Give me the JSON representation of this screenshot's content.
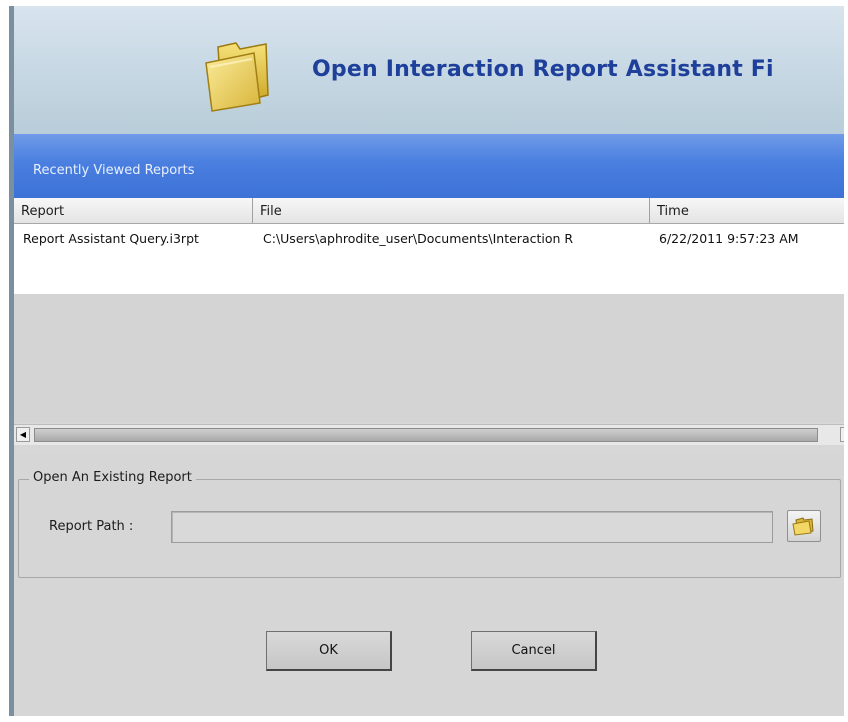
{
  "header": {
    "title": "Open Interaction Report Assistant Fi",
    "icon": "folder-icon"
  },
  "recent": {
    "section_label": "Recently Viewed Reports",
    "columns": [
      "Report",
      "File",
      "Time"
    ],
    "rows": [
      {
        "report": "Report Assistant Query.i3rpt",
        "file": "C:\\Users\\aphrodite_user\\Documents\\Interaction R",
        "time": "6/22/2011 9:57:23 AM"
      }
    ]
  },
  "open_existing": {
    "group_title": "Open An Existing Report",
    "path_label": "Report Path :",
    "path_value": "",
    "browse_icon": "folder-icon"
  },
  "buttons": {
    "ok": "OK",
    "cancel": "Cancel"
  },
  "colors": {
    "title_text": "#1e3f9a",
    "band": "#4a7fe0",
    "window_bg": "#d6d6d6"
  }
}
